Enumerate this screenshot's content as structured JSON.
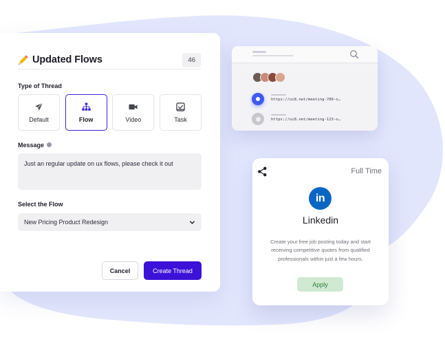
{
  "colors": {
    "accent": "#3d12d8",
    "selected_border": "#3d2bd6",
    "blob": "#e2e6fd",
    "linkedin": "#0a66c2",
    "apply_bg": "#cfe9d2",
    "apply_text": "#2f7d3c",
    "radio_on": "#4158f0"
  },
  "thread_form": {
    "title": "Updated Flows",
    "title_icon": "pencil-icon",
    "count": "46",
    "type_label": "Type of Thread",
    "types": [
      {
        "label": "Default",
        "icon": "paper-plane-icon",
        "selected": false
      },
      {
        "label": "Flow",
        "icon": "flow-chart-icon",
        "selected": true
      },
      {
        "label": "Video",
        "icon": "video-camera-icon",
        "selected": false
      },
      {
        "label": "Task",
        "icon": "task-check-icon",
        "selected": false
      }
    ],
    "message_label": "Message",
    "message_value": "Just an regular update on ux flows, please check it out",
    "flow_label": "Select the Flow",
    "flow_value": "New Pricing Product Redesign",
    "cancel_label": "Cancel",
    "create_label": "Create Thread"
  },
  "meeting_card": {
    "avatars": [
      "#6b5b53",
      "#c98a78",
      "#8a4a3c",
      "#d9a58c"
    ],
    "rows": [
      {
        "url": "https://ui8.net/meeting-789-o…",
        "selected": true
      },
      {
        "url": "https://ui8.net/meeting-123-o…",
        "selected": false
      }
    ]
  },
  "job_card": {
    "type": "Full Time",
    "logo_text": "in",
    "company": "Linkedin",
    "description": "Create your free job posting today and start receiving competitive quotes from qualified professionals within just a few hours.",
    "apply_label": "Apply"
  }
}
